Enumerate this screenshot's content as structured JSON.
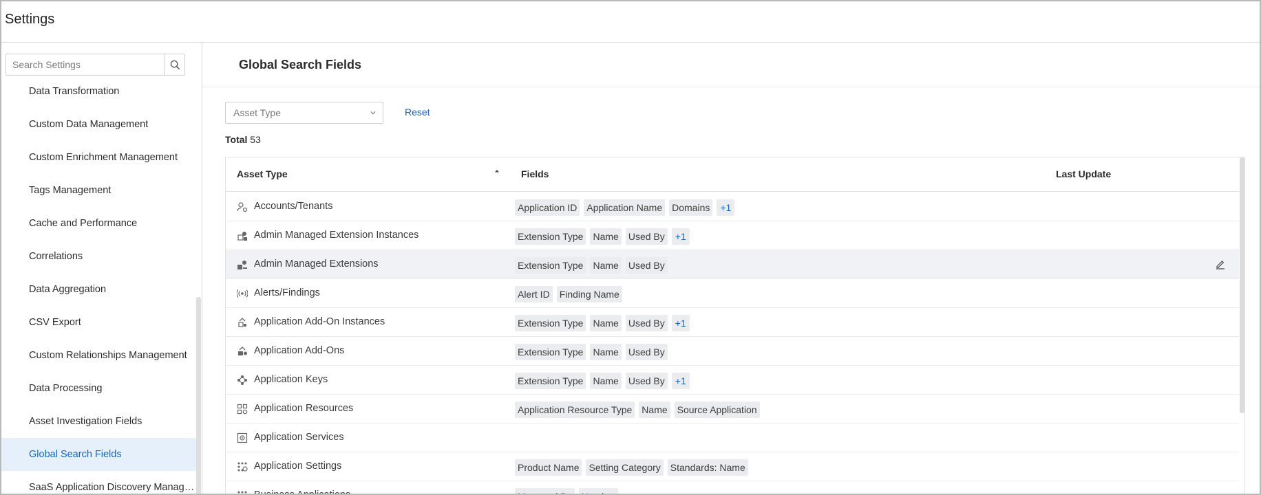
{
  "app": {
    "title": "Settings"
  },
  "sidebar": {
    "search_placeholder": "Search Settings",
    "items": [
      {
        "label": "Data Transformation",
        "active": false
      },
      {
        "label": "Custom Data Management",
        "active": false
      },
      {
        "label": "Custom Enrichment Management",
        "active": false
      },
      {
        "label": "Tags Management",
        "active": false
      },
      {
        "label": "Cache and Performance",
        "active": false
      },
      {
        "label": "Correlations",
        "active": false
      },
      {
        "label": "Data Aggregation",
        "active": false
      },
      {
        "label": "CSV Export",
        "active": false
      },
      {
        "label": "Custom Relationships Management",
        "active": false
      },
      {
        "label": "Data Processing",
        "active": false
      },
      {
        "label": "Asset Investigation Fields",
        "active": false
      },
      {
        "label": "Global Search Fields",
        "active": true
      },
      {
        "label": "SaaS Application Discovery Manage…",
        "active": false
      }
    ]
  },
  "main": {
    "title": "Global Search Fields",
    "filter_placeholder": "Asset Type",
    "reset_label": "Reset",
    "total_label": "Total",
    "total_count": "53",
    "columns": {
      "asset_type": "Asset Type",
      "fields": "Fields",
      "last_update": "Last Update"
    },
    "rows": [
      {
        "name": "Accounts/Tenants",
        "icon": "accounts-tenants-icon",
        "tags": [
          "Application ID",
          "Application Name",
          "Domains"
        ],
        "more": "+1"
      },
      {
        "name": "Admin Managed Extension Instances",
        "icon": "extension-instances-icon",
        "tags": [
          "Extension Type",
          "Name",
          "Used By"
        ],
        "more": "+1"
      },
      {
        "name": "Admin Managed Extensions",
        "icon": "extensions-icon",
        "tags": [
          "Extension Type",
          "Name",
          "Used By"
        ],
        "more": "",
        "hover": true
      },
      {
        "name": "Alerts/Findings",
        "icon": "alerts-findings-icon",
        "tags": [
          "Alert ID",
          "Finding Name"
        ],
        "more": ""
      },
      {
        "name": "Application Add-On Instances",
        "icon": "addon-instances-icon",
        "tags": [
          "Extension Type",
          "Name",
          "Used By"
        ],
        "more": "+1"
      },
      {
        "name": "Application Add-Ons",
        "icon": "addons-icon",
        "tags": [
          "Extension Type",
          "Name",
          "Used By"
        ],
        "more": ""
      },
      {
        "name": "Application Keys",
        "icon": "application-keys-icon",
        "tags": [
          "Extension Type",
          "Name",
          "Used By"
        ],
        "more": "+1"
      },
      {
        "name": "Application Resources",
        "icon": "application-resources-icon",
        "tags": [
          "Application Resource Type",
          "Name",
          "Source Application"
        ],
        "more": ""
      },
      {
        "name": "Application Services",
        "icon": "application-services-icon",
        "tags": [],
        "more": ""
      },
      {
        "name": "Application Settings",
        "icon": "application-settings-icon",
        "tags": [
          "Product Name",
          "Setting Category",
          "Standards: Name"
        ],
        "more": ""
      },
      {
        "name": "Business Applications",
        "icon": "business-applications-icon",
        "tags": [
          "Managed By",
          "Number"
        ],
        "more": ""
      }
    ]
  },
  "colors": {
    "accent": "#1565c0",
    "active_bg": "#e6f0fb",
    "tag_bg": "#ebecef",
    "hover_row": "#f0f2f6"
  }
}
